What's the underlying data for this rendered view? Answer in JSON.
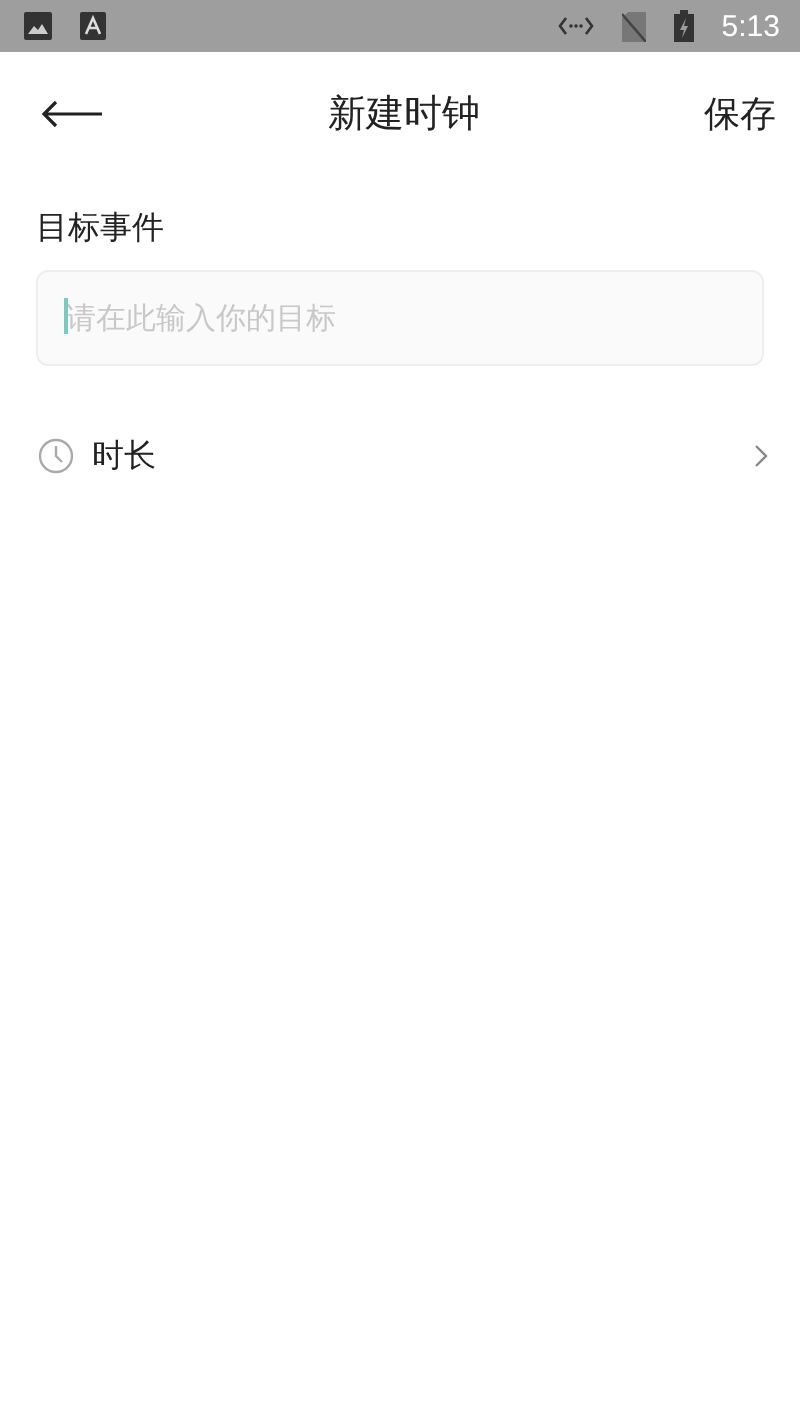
{
  "status_bar": {
    "time": "5:13"
  },
  "header": {
    "title": "新建时钟",
    "action": "保存"
  },
  "goal": {
    "label": "目标事件",
    "placeholder": "请在此输入你的目标",
    "focused": true
  },
  "duration": {
    "label": "时长"
  }
}
